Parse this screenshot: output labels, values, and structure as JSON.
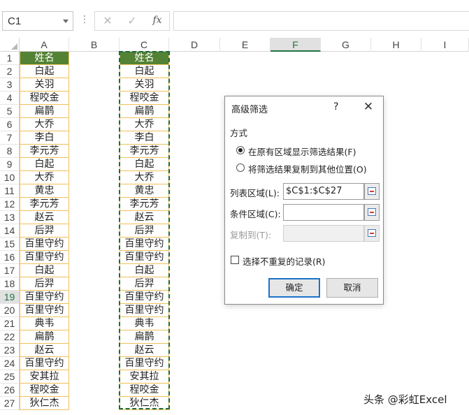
{
  "formula_bar": {
    "name_box": "C1",
    "dots": "⋮",
    "cancel_icon": "✕",
    "enter_icon": "✓",
    "fx_label": "fx",
    "formula": ""
  },
  "columns": [
    "A",
    "B",
    "C",
    "D",
    "E",
    "F",
    "G",
    "H",
    "I"
  ],
  "selected_column": "F",
  "rows": [
    {
      "n": "1",
      "a": "姓名",
      "c": "姓名"
    },
    {
      "n": "2",
      "a": "白起",
      "c": "白起"
    },
    {
      "n": "3",
      "a": "关羽",
      "c": "关羽"
    },
    {
      "n": "4",
      "a": "程咬金",
      "c": "程咬金"
    },
    {
      "n": "5",
      "a": "扁鹊",
      "c": "扁鹊"
    },
    {
      "n": "6",
      "a": "大乔",
      "c": "大乔"
    },
    {
      "n": "7",
      "a": "李白",
      "c": "李白"
    },
    {
      "n": "8",
      "a": "李元芳",
      "c": "李元芳"
    },
    {
      "n": "9",
      "a": "白起",
      "c": "白起"
    },
    {
      "n": "10",
      "a": "大乔",
      "c": "大乔"
    },
    {
      "n": "11",
      "a": "黄忠",
      "c": "黄忠"
    },
    {
      "n": "12",
      "a": "李元芳",
      "c": "李元芳"
    },
    {
      "n": "13",
      "a": "赵云",
      "c": "赵云"
    },
    {
      "n": "14",
      "a": "后羿",
      "c": "后羿"
    },
    {
      "n": "15",
      "a": "百里守约",
      "c": "百里守约"
    },
    {
      "n": "16",
      "a": "百里守约",
      "c": "百里守约"
    },
    {
      "n": "17",
      "a": "白起",
      "c": "白起"
    },
    {
      "n": "18",
      "a": "后羿",
      "c": "后羿"
    },
    {
      "n": "19",
      "a": "百里守约",
      "c": "百里守约"
    },
    {
      "n": "20",
      "a": "百里守约",
      "c": "百里守约"
    },
    {
      "n": "21",
      "a": "典韦",
      "c": "典韦"
    },
    {
      "n": "22",
      "a": "扁鹊",
      "c": "扁鹊"
    },
    {
      "n": "23",
      "a": "赵云",
      "c": "赵云"
    },
    {
      "n": "24",
      "a": "百里守约",
      "c": "百里守约"
    },
    {
      "n": "25",
      "a": "安其拉",
      "c": "安其拉"
    },
    {
      "n": "26",
      "a": "程咬金",
      "c": "程咬金"
    },
    {
      "n": "27",
      "a": "狄仁杰",
      "c": "狄仁杰"
    }
  ],
  "selected_row": "19",
  "dialog": {
    "title": "高级筛选",
    "help": "?",
    "close": "✕",
    "group_label": "方式",
    "option1": "在原有区域显示筛选结果(F)",
    "option2": "将筛选结果复制到其他位置(O)",
    "list_range_label": "列表区域(L):",
    "list_range_value": "$C$1:$C$27",
    "criteria_label": "条件区域(C):",
    "criteria_value": "",
    "copy_to_label": "复制到(T):",
    "copy_to_value": "",
    "unique_label": "选择不重复的记录(R)",
    "ok": "确定",
    "cancel": "取消"
  },
  "watermark": "头条 @彩虹Excel"
}
